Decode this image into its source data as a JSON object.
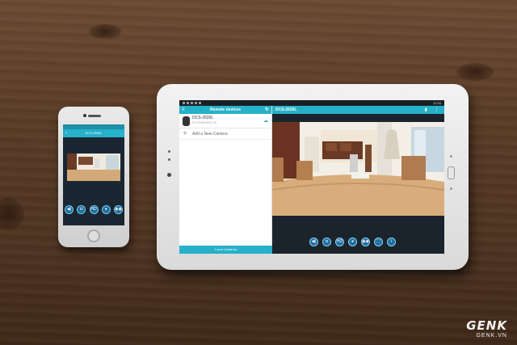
{
  "phone": {
    "app_title": "DCS-2630L",
    "right_label": "...",
    "controls": [
      "◀)",
      "◘",
      "HD",
      "●",
      "◉◉"
    ]
  },
  "tablet": {
    "status_time": "12:34",
    "left": {
      "header": "Remote devices",
      "device_name": "DCS-2630L",
      "device_sub": "F0:7D:68:03:9C:F8",
      "add_label": "Add a New Camera",
      "footer": "Local Cameras"
    },
    "right": {
      "header": "DCS-2630L",
      "controls": [
        "◀)",
        "◘",
        "HD",
        "●",
        "◉◉",
        "⛶",
        "i"
      ]
    }
  },
  "watermark": {
    "logo": "GENK",
    "site": "GENK.VN"
  },
  "colors": {
    "accent": "#26b0c9",
    "wood": "#5a3c27"
  }
}
